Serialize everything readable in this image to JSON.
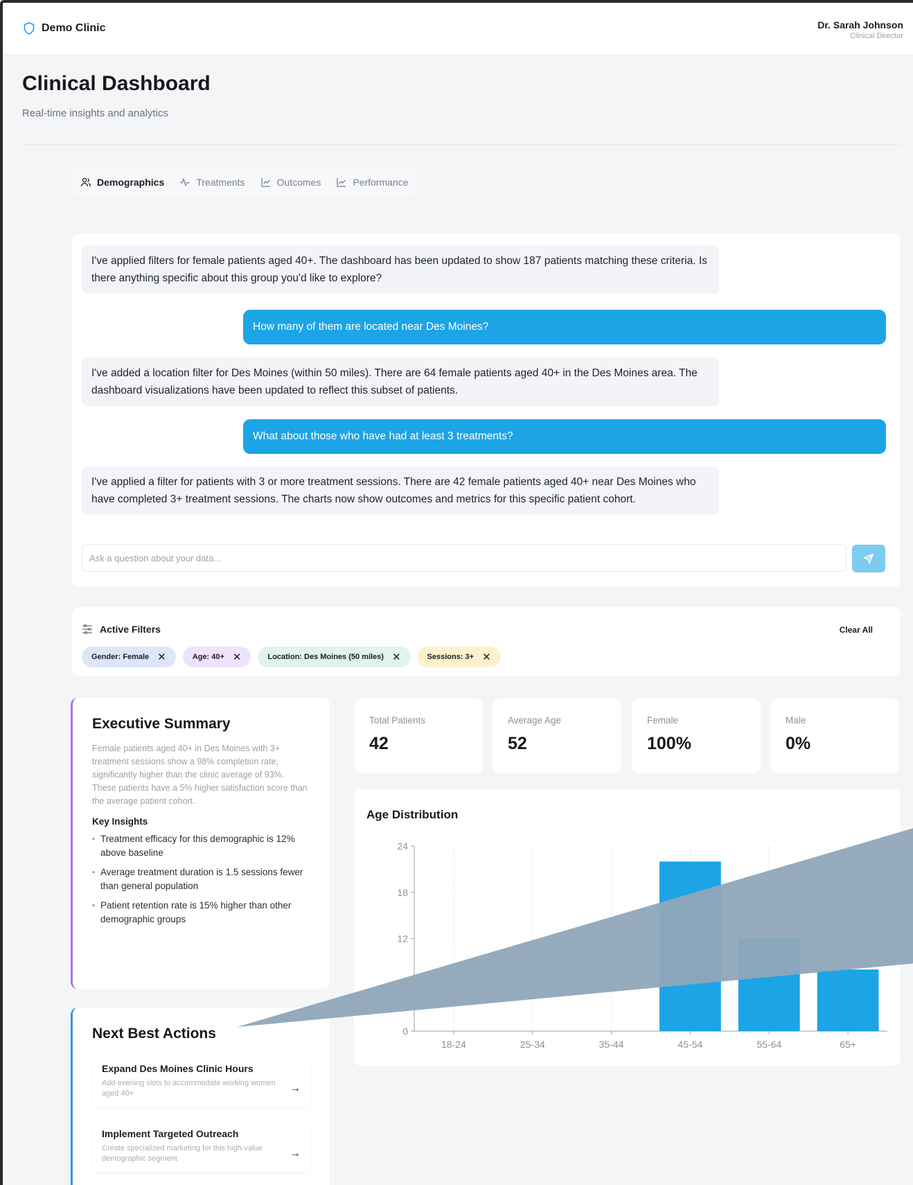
{
  "header": {
    "brand": "Demo Clinic",
    "user_name": "Dr. Sarah Johnson",
    "user_role": "Clinical Director"
  },
  "page": {
    "title": "Clinical Dashboard",
    "subtitle": "Real-time insights and analytics"
  },
  "tabs": [
    {
      "label": "Demographics",
      "icon": "users-icon",
      "active": true
    },
    {
      "label": "Treatments",
      "icon": "activity-icon",
      "active": false
    },
    {
      "label": "Outcomes",
      "icon": "line-chart-icon",
      "active": false
    },
    {
      "label": "Performance",
      "icon": "line-chart-icon",
      "active": false
    }
  ],
  "chat": {
    "messages": [
      {
        "role": "assistant",
        "text": "I've applied filters for female patients aged 40+. The dashboard has been updated to show 187 patients matching these criteria. Is there anything specific about this group you'd like to explore?"
      },
      {
        "role": "user",
        "text": "How many of them are located near Des Moines?"
      },
      {
        "role": "assistant",
        "text": "I've added a location filter for Des Moines (within 50 miles). There are 64 female patients aged 40+ in the Des Moines area. The dashboard visualizations have been updated to reflect this subset of patients."
      },
      {
        "role": "user",
        "text": "What about those who have had at least 3 treatments?"
      },
      {
        "role": "assistant",
        "text": "I've applied a filter for patients with 3 or more treatment sessions. There are 42 female patients aged 40+ near Des Moines who have completed 3+ treatment sessions. The charts now show outcomes and metrics for this specific patient cohort."
      }
    ],
    "input_placeholder": "Ask a question about your data...",
    "input_value": ""
  },
  "filters": {
    "title": "Active Filters",
    "clear_label": "Clear All",
    "chips": [
      {
        "label": "Gender: Female",
        "color": "#dde6f7"
      },
      {
        "label": "Age: 40+",
        "color": "#efe3fb"
      },
      {
        "label": "Location: Des Moines (50 miles)",
        "color": "#e0f4ea"
      },
      {
        "label": "Sessions: 3+",
        "color": "#fcf1cf"
      }
    ]
  },
  "summary": {
    "title": "Executive Summary",
    "text": "Female patients aged 40+ in Des Moines with 3+ treatment sessions show a 98% completion rate, significantly higher than the clinic average of 93%. These patients have a 5% higher satisfaction score than the average patient cohort.",
    "insights_title": "Key Insights",
    "insights": [
      "Treatment efficacy for this demographic is 12% above baseline",
      "Average treatment duration is 1.5 sessions fewer than general population",
      "Patient retention rate is 15% higher than other demographic groups"
    ]
  },
  "actions": {
    "title": "Next Best Actions",
    "items": [
      {
        "title": "Expand Des Moines Clinic Hours",
        "desc": "Add evening slots to accommodate working women aged 40+"
      },
      {
        "title": "Implement Targeted Outreach",
        "desc": "Create specialized marketing for this high-value demographic segment"
      }
    ]
  },
  "stats": [
    {
      "label": "Total Patients",
      "value": "42"
    },
    {
      "label": "Average Age",
      "value": "52"
    },
    {
      "label": "Female",
      "value": "100%"
    },
    {
      "label": "Male",
      "value": "0%"
    }
  ],
  "colors": {
    "accent": "#1ca4e6",
    "bar": "#1ca4e6",
    "summary_border": "#a56ef0",
    "actions_border": "#2e95e8"
  },
  "chart_data": {
    "type": "bar",
    "title": "Age Distribution",
    "categories": [
      "18-24",
      "25-34",
      "35-44",
      "45-54",
      "55-64",
      "65+"
    ],
    "values": [
      0,
      0,
      0,
      22,
      12,
      8
    ],
    "y_ticks": [
      0,
      6,
      12,
      18,
      24
    ],
    "ylim": [
      0,
      24
    ],
    "grid": "vertical dashed"
  }
}
